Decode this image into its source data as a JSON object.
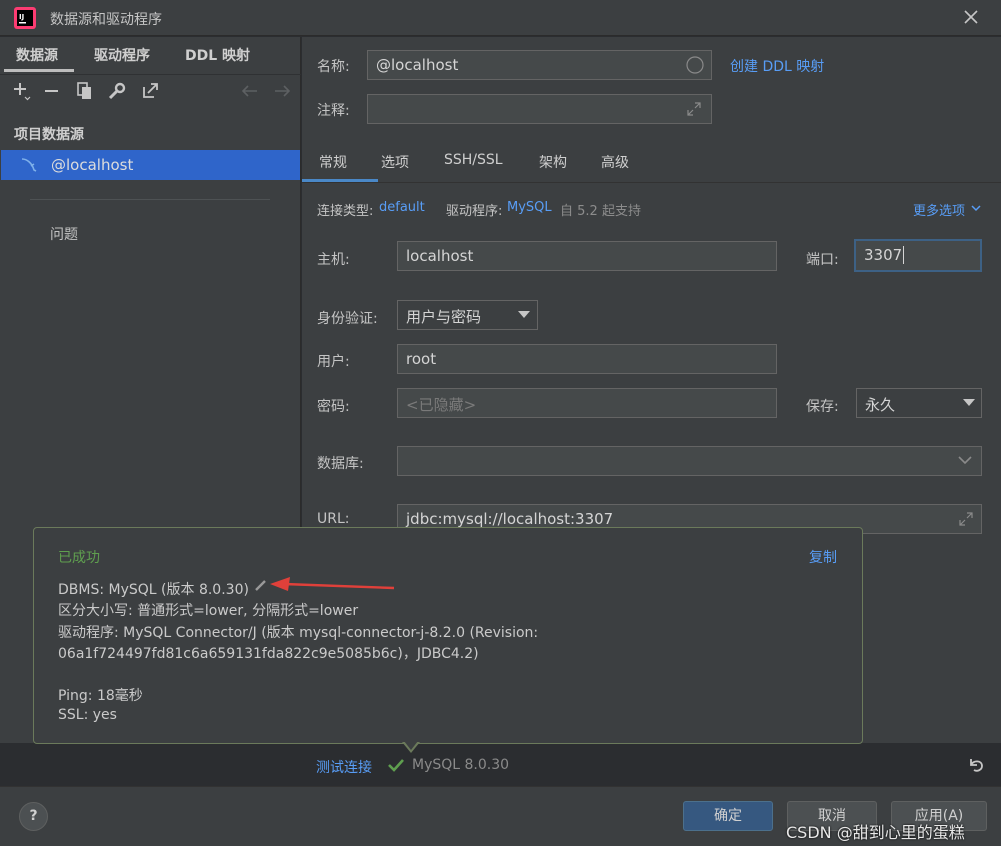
{
  "window": {
    "title": "数据源和驱动程序"
  },
  "sidebar": {
    "tabs": [
      "数据源",
      "驱动程序",
      "DDL 映射"
    ],
    "section_title": "项目数据源",
    "selected_source": "@localhost",
    "problems": "问题"
  },
  "form": {
    "name_label": "名称:",
    "name_value": "@localhost",
    "create_ddl_link": "创建 DDL 映射",
    "comment_label": "注释:",
    "tabs": [
      "常规",
      "选项",
      "SSH/SSL",
      "架构",
      "高级"
    ],
    "conn_type_label": "连接类型:",
    "conn_type_value": "default",
    "driver_label": "驱动程序:",
    "driver_value": "MySQL",
    "driver_note": "自 5.2 起支持",
    "more_options": "更多选项",
    "host_label": "主机:",
    "host_value": "localhost",
    "port_label": "端口:",
    "port_value": "3307",
    "auth_label": "身份验证:",
    "auth_value": "用户与密码",
    "user_label": "用户:",
    "user_value": "root",
    "password_label": "密码:",
    "password_placeholder": "<已隐藏>",
    "save_label": "保存:",
    "save_value": "永久",
    "database_label": "数据库:",
    "url_label": "URL:",
    "url_value": "jdbc:mysql://localhost:3307"
  },
  "popup": {
    "status": "已成功",
    "copy": "复制",
    "dbms_line": "DBMS: MySQL (版本 8.0.30)",
    "case_line": "区分大小写: 普通形式=lower, 分隔形式=lower",
    "driver_line1": "驱动程序: MySQL Connector/J (版本 mysql-connector-j-8.2.0 (Revision:",
    "driver_line2": "06a1f724497fd81c6a659131fda822c9e5085b6c)，JDBC4.2)",
    "ping_line": "Ping: 18毫秒",
    "ssl_line": "SSL: yes"
  },
  "test": {
    "link": "测试连接",
    "result": "MySQL 8.0.30"
  },
  "bottom": {
    "help": "?",
    "ok": "确定",
    "cancel": "取消",
    "apply": "应用(A)",
    "watermark": "CSDN @甜到心里的蛋糕"
  },
  "colors": {
    "accent": "#589df6",
    "selection": "#2f65ca",
    "success": "#5f9f4f",
    "arrow": "#e0403a"
  }
}
